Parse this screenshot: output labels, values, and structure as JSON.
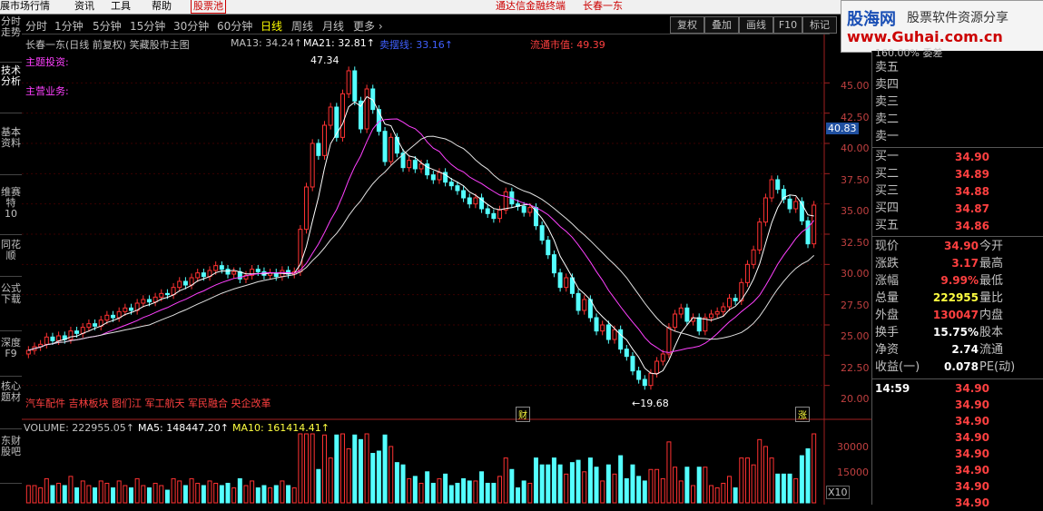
{
  "menubar": {
    "items": [
      "展市场行情",
      "资讯",
      "工具",
      "帮助"
    ],
    "selected": "股票池",
    "center_title": "通达信金融终端",
    "stock_title": "长春一东"
  },
  "left_tabs": [
    "分时走势",
    "技术分析",
    "基本资料",
    "维赛特10",
    "同花顺",
    "公式下载",
    "深度F9",
    "核心题材",
    "东财股吧"
  ],
  "periods": [
    "分时",
    "1分钟",
    "5分钟",
    "15分钟",
    "30分钟",
    "60分钟",
    "日线",
    "周线",
    "月线",
    "更多 ›"
  ],
  "active_period": "日线",
  "toolbar_buttons": [
    "复权",
    "叠加",
    "画线",
    "F10",
    "标记"
  ],
  "chart_header": {
    "title": "长春一东(日线 前复权) 笑藏股市主图",
    "ma13": "MA13: 34.24↑",
    "ma21": "MA21: 32.81↑",
    "ma_label3": "卖摆线: 33.16↑",
    "market_cap": "流通市值: 49.39"
  },
  "annotations": {
    "theme_invest": "主题投资:",
    "main_business": "主营业务:",
    "concepts": "汽车配件 吉林板块 图们江 军工航天 军民融合 央企改革",
    "high_label": "47.34",
    "low_label": "←19.68",
    "fin_marker": "财",
    "limit_marker": "涨",
    "price_tag": "40.83"
  },
  "chart_data": {
    "type": "candlestick",
    "y_axis_ticks": [
      "45.00",
      "42.50",
      "40.00",
      "37.50",
      "35.00",
      "32.50",
      "30.00",
      "27.50",
      "25.00",
      "22.50",
      "20.00"
    ],
    "ylim": [
      19.0,
      47.5
    ],
    "high": 47.34,
    "low": 19.68,
    "last_close": 34.9,
    "volume_ticks": [
      "30000",
      "15000"
    ],
    "volume_unit": "X10",
    "closes": [
      22.9,
      23.2,
      23.4,
      24.0,
      23.7,
      24.1,
      23.8,
      24.5,
      24.3,
      24.8,
      25.1,
      24.9,
      25.4,
      25.8,
      25.6,
      26.1,
      26.4,
      26.2,
      26.8,
      27.1,
      26.9,
      27.3,
      27.6,
      27.5,
      28.1,
      28.6,
      28.3,
      28.9,
      29.3,
      29.0,
      29.5,
      29.9,
      29.6,
      29.2,
      29.4,
      28.8,
      29.1,
      29.6,
      29.4,
      29.1,
      29.3,
      29.0,
      29.5,
      29.2,
      29.4,
      32.9,
      36.4,
      40.0,
      39.0,
      41.5,
      43.0,
      40.5,
      44.1,
      46.0,
      43.5,
      41.2,
      44.5,
      42.8,
      41.0,
      38.5,
      40.5,
      39.2,
      38.0,
      38.6,
      37.9,
      38.3,
      37.4,
      37.0,
      37.6,
      36.8,
      36.5,
      36.1,
      35.5,
      35.0,
      35.5,
      34.6,
      34.2,
      33.8,
      34.5,
      36.0,
      35.0,
      34.8,
      34.3,
      34.7,
      33.2,
      32.0,
      30.8,
      29.3,
      28.1,
      28.9,
      27.6,
      26.2,
      27.1,
      25.6,
      24.5,
      25.0,
      23.8,
      24.6,
      23.0,
      22.4,
      21.2,
      20.5,
      20.0,
      21.0,
      22.0,
      22.6,
      24.8,
      25.9,
      26.4,
      25.3,
      25.6,
      24.5,
      25.6,
      25.9,
      26.1,
      26.5,
      27.2,
      27.0,
      28.5,
      30.0,
      31.2,
      33.5,
      35.5,
      37.0,
      36.2,
      35.4,
      34.6,
      35.2,
      33.6,
      31.7,
      34.9
    ],
    "volume": {
      "current": "VOLUME: 222955.05↑",
      "ma5": "MA5: 148447.20↑",
      "ma10": "MA10: 161414.41↑"
    }
  },
  "order_book": {
    "top_partial": "160.00% 委差",
    "sells": [
      {
        "label": "卖五",
        "price": ""
      },
      {
        "label": "卖四",
        "price": ""
      },
      {
        "label": "卖三",
        "price": ""
      },
      {
        "label": "卖二",
        "price": ""
      },
      {
        "label": "卖一",
        "price": ""
      }
    ],
    "buys": [
      {
        "label": "买一",
        "price": "34.90"
      },
      {
        "label": "买二",
        "price": "34.89"
      },
      {
        "label": "买三",
        "price": "34.88"
      },
      {
        "label": "买四",
        "price": "34.87"
      },
      {
        "label": "买五",
        "price": "34.86"
      }
    ]
  },
  "stats": [
    {
      "label": "现价",
      "value": "34.90",
      "right": "今开",
      "color": "#ff4040"
    },
    {
      "label": "涨跌",
      "value": "3.17",
      "right": "最高",
      "color": "#ff4040"
    },
    {
      "label": "涨幅",
      "value": "9.99%",
      "right": "最低",
      "color": "#ff4040"
    },
    {
      "label": "总量",
      "value": "222955",
      "right": "量比",
      "color": "#ffff40"
    },
    {
      "label": "外盘",
      "value": "130047",
      "right": "内盘",
      "color": "#ff4040"
    },
    {
      "label": "换手",
      "value": "15.75%",
      "right": "股本",
      "color": "#ffffff"
    },
    {
      "label": "净资",
      "value": "2.74",
      "right": "流通",
      "color": "#ffffff"
    },
    {
      "label": "收益(一)",
      "value": "0.078",
      "right": "PE(动)",
      "color": "#ffffff"
    }
  ],
  "ticks": [
    {
      "time": "14:59",
      "price": "34.90"
    },
    {
      "time": "",
      "price": "34.90"
    },
    {
      "time": "",
      "price": "34.90"
    },
    {
      "time": "",
      "price": "34.90"
    },
    {
      "time": "",
      "price": "34.90"
    },
    {
      "time": "",
      "price": "34.90"
    },
    {
      "time": "",
      "price": "34.90"
    },
    {
      "time": "",
      "price": "34.90"
    }
  ],
  "logo": {
    "brand": "股海网",
    "tagline": "股票软件资源分享",
    "url": "www.Guhai.com.cn"
  }
}
